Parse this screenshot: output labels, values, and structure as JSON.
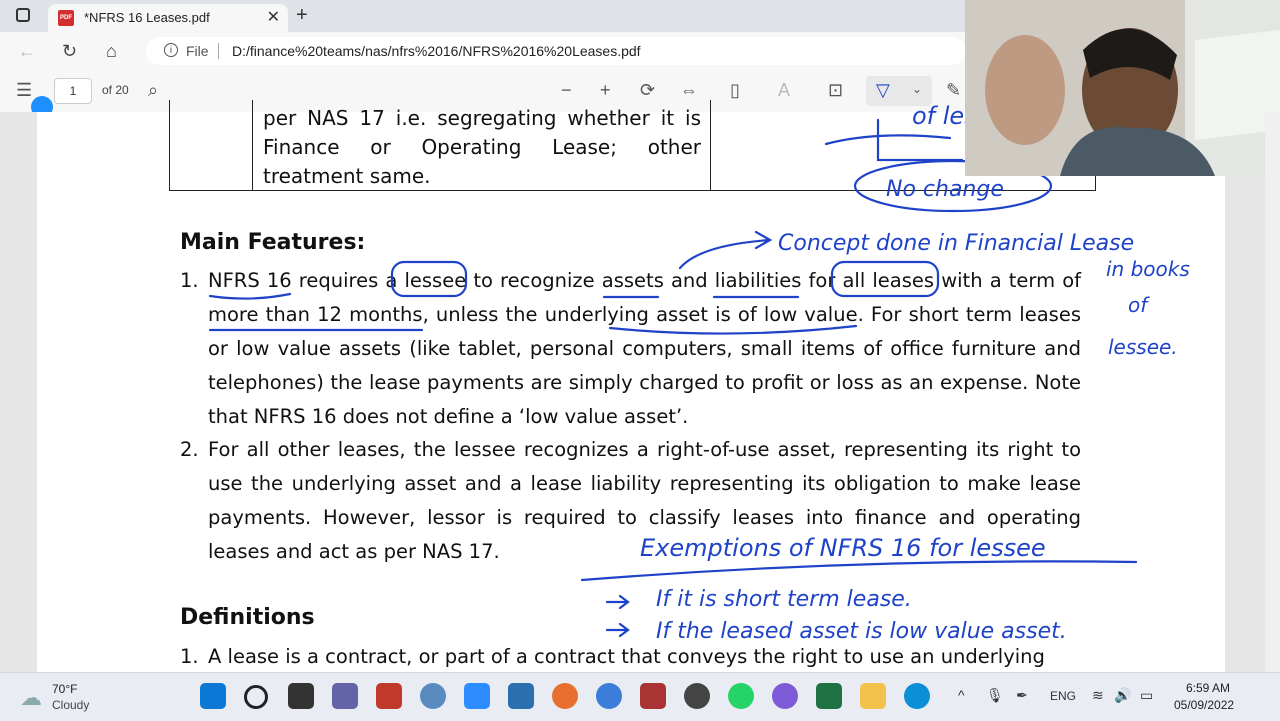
{
  "browser": {
    "tab_title": "*NFRS 16 Leases.pdf",
    "new_tab_symbol": "+",
    "close_symbol": "✕",
    "file_label": "File",
    "url": "D:/finance%20teams/nas/nfrs%2016/NFRS%2016%20Leases.pdf"
  },
  "pdf_toolbar": {
    "page_number": "1",
    "page_count_label": "of 20",
    "icons": [
      "contents-icon",
      "search-icon",
      "zoom-out-icon",
      "zoom-in-icon",
      "rotate-icon",
      "fit-page-icon",
      "page-view-icon",
      "read-aloud-icon",
      "text-box-icon",
      "draw-icon",
      "chevron-down-icon",
      "highlight-icon"
    ]
  },
  "document": {
    "table_cell_text": "per NAS 17 i.e. segregating whether it is Finance or Operating Lease; other treatment same.",
    "main_features_heading": "Main Features:",
    "features": [
      {
        "num": "1.",
        "text": "NFRS 16 requires a lessee to recognize assets and liabilities for all leases with a term of more than 12 months, unless the underlying asset is of low value. For short term leases or low value assets (like tablet, personal computers, small items of office furniture and telephones) the lease payments are simply charged to profit or loss as an expense. Note that NFRS 16 does not define a ‘low value asset’."
      },
      {
        "num": "2.",
        "text": "For all other leases, the lessee recognizes a right-of-use asset, representing its right to use the underlying asset and a lease liability representing its obligation to make lease payments. However, lessor is required to classify leases into finance and operating leases and act as per NAS 17."
      }
    ],
    "definitions_heading": "Definitions",
    "definitions": [
      {
        "num": "1.",
        "text": "A lease is a contract, or part of a contract that conveys the right to use an underlying"
      }
    ]
  },
  "annotations": {
    "top_partial": "of lesso",
    "no_change": "No change",
    "concept": "Concept done in Financial Lease",
    "books_line1": "in books",
    "books_line2": "of",
    "books_line3": "lessee.",
    "exemptions_title": "Exemptions of NFRS 16 for lessee",
    "exemption_1": "If it is short term lease.",
    "exemption_2": "If the leased asset is low value asset."
  },
  "taskbar": {
    "weather_temp": "70°F",
    "weather_desc": "Cloudy",
    "language": "ENG",
    "time": "6:59 AM",
    "date": "05/09/2022"
  },
  "colors": {
    "ink": "#1f43c8",
    "pdf_red": "#d32f2f",
    "accent_blue": "#0067c0"
  }
}
